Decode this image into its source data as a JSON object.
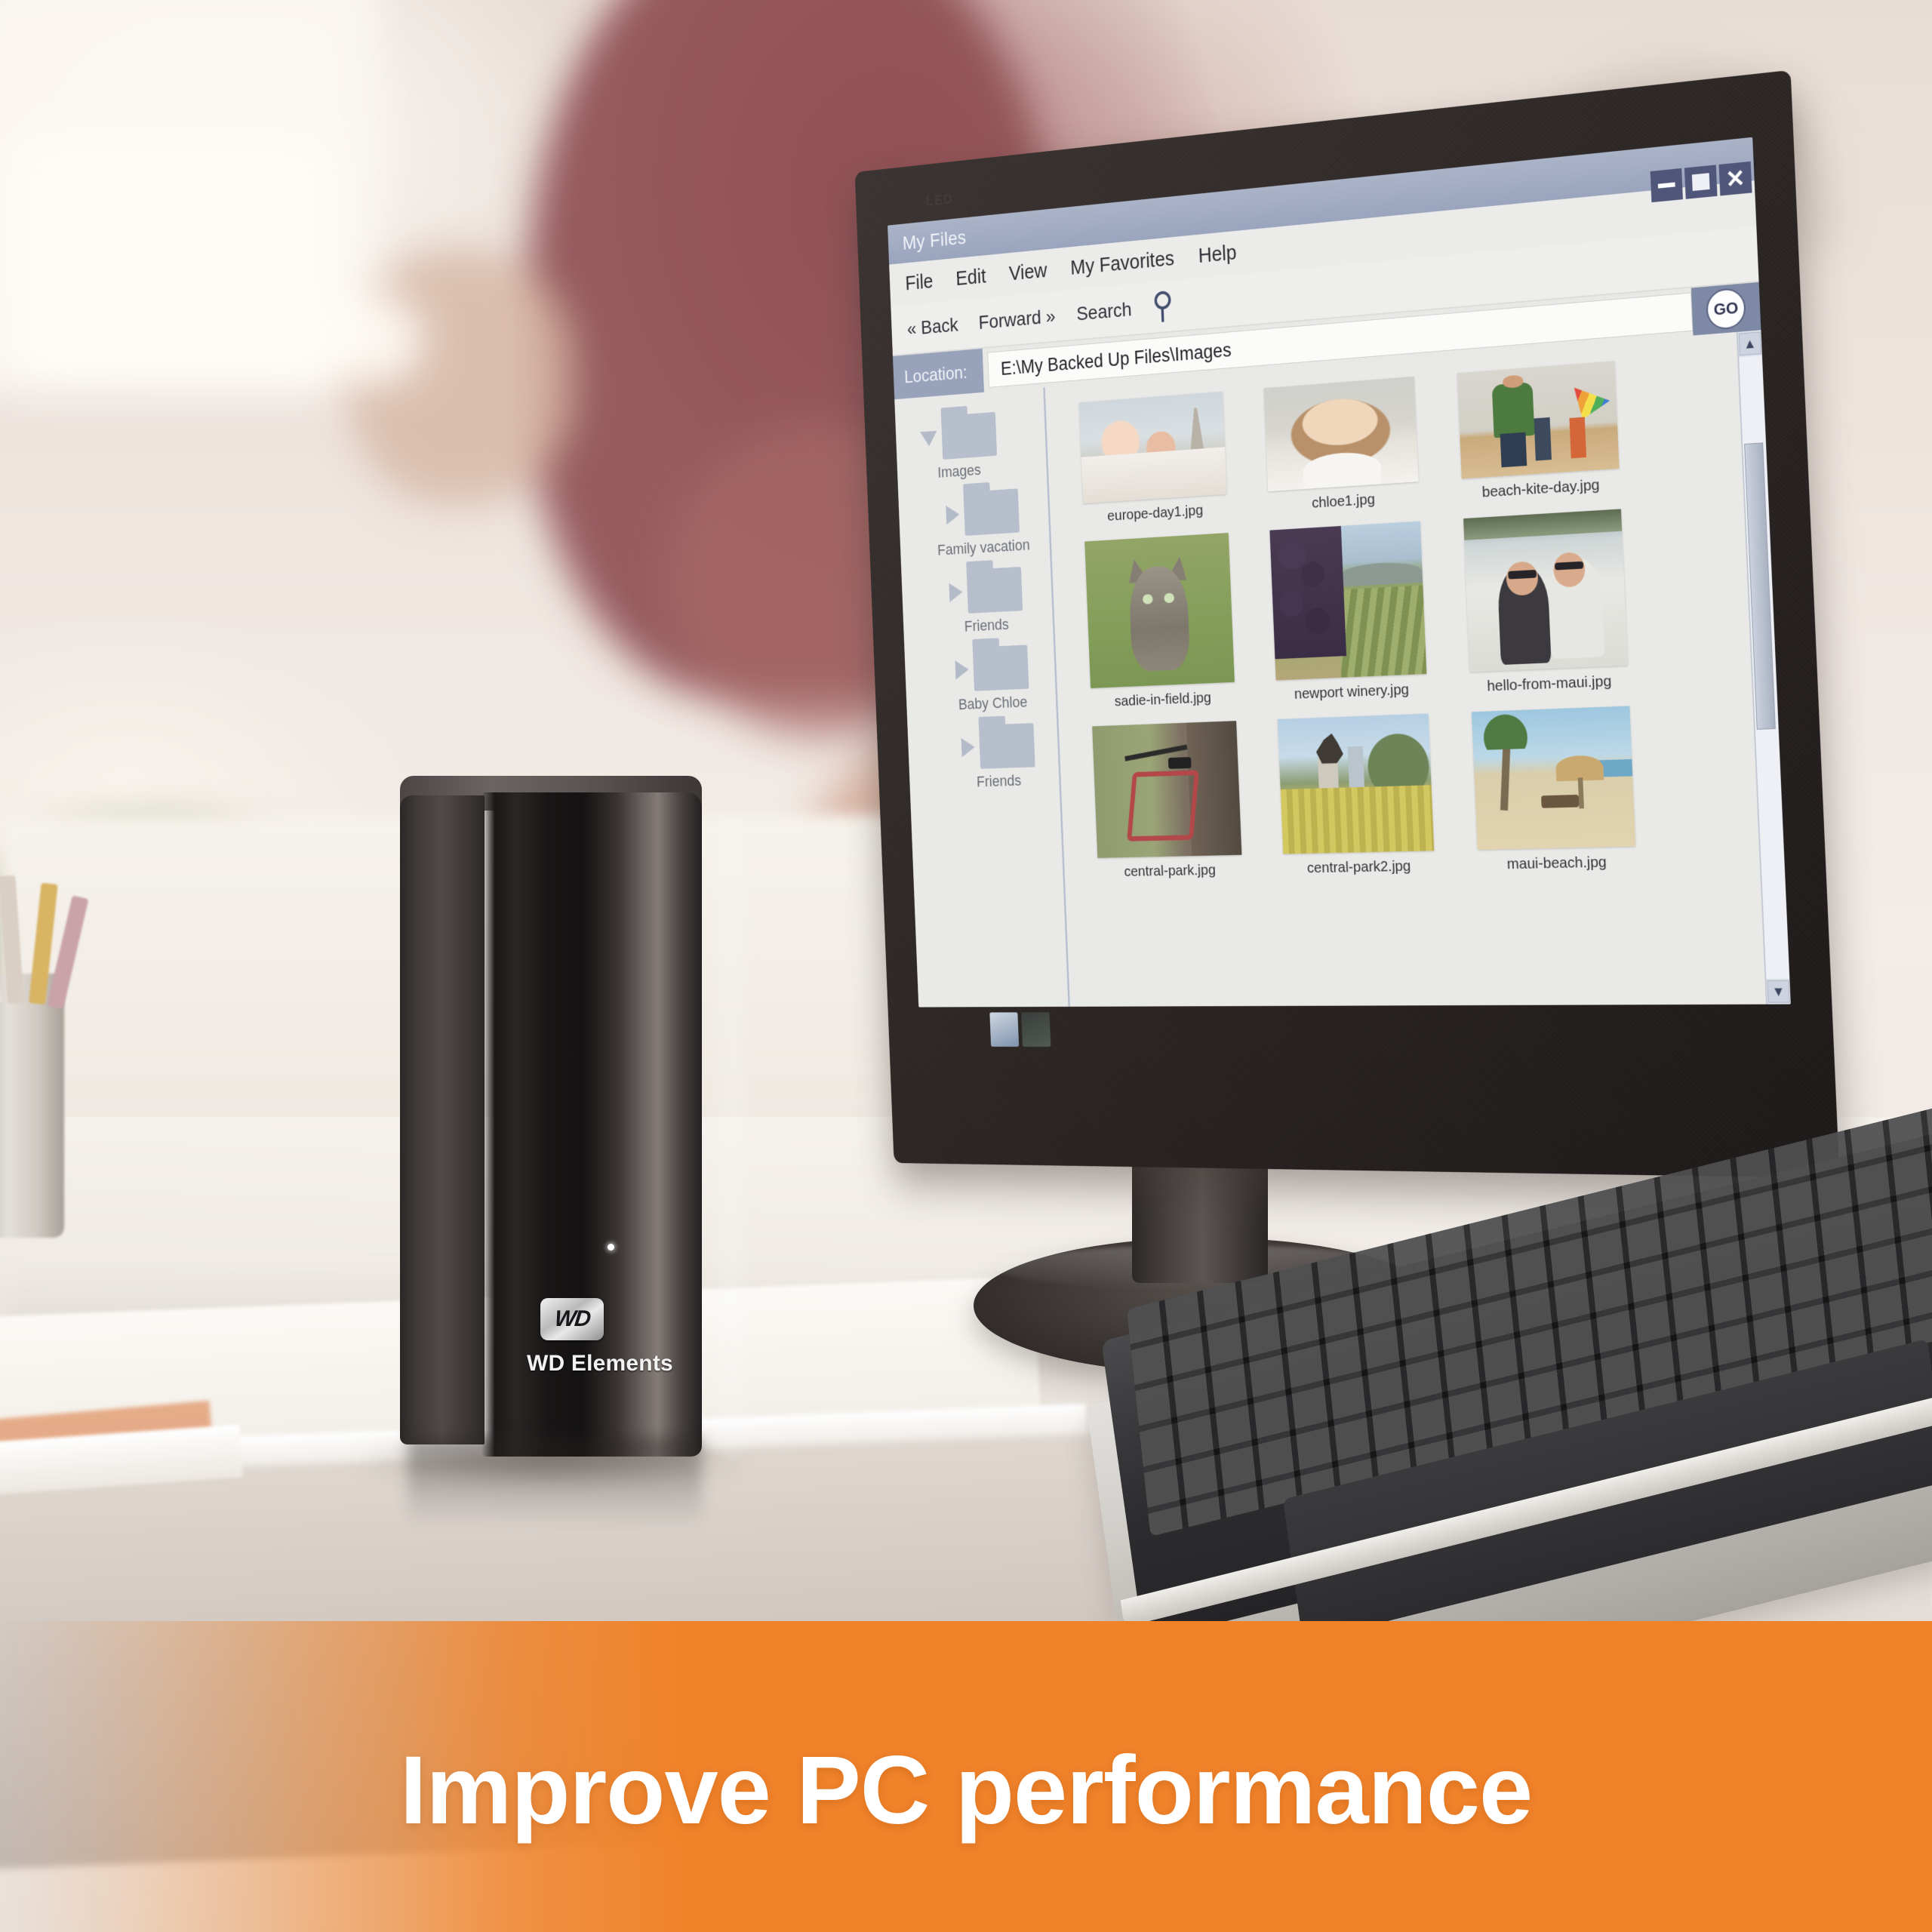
{
  "scene": {
    "monitor": {
      "bezel_label": "LED",
      "badges": [
        "energy-star-sticker",
        "eco-sticker"
      ]
    },
    "drive": {
      "brand_mark": "WD",
      "model_label": "WD Elements",
      "led_indicator": "power-led"
    }
  },
  "window": {
    "title": "My Files",
    "controls": {
      "minimize": "–",
      "maximize": "□",
      "close": "✕"
    },
    "menu": [
      "File",
      "Edit",
      "View",
      "My Favorites",
      "Help"
    ],
    "toolbar": {
      "back": "« Back",
      "forward": "Forward »",
      "search": "Search",
      "search_icon": "magnifier-icon"
    },
    "location": {
      "label": "Location:",
      "value": "E:\\My Backed Up Files\\Images",
      "go_label": "GO"
    },
    "tree": [
      {
        "label": "Images",
        "expanded": true,
        "indent": 0
      },
      {
        "label": "Family vacation",
        "expanded": false,
        "indent": 1
      },
      {
        "label": "Friends",
        "expanded": false,
        "indent": 1
      },
      {
        "label": "Baby Chloe",
        "expanded": false,
        "indent": 1
      },
      {
        "label": "Friends",
        "expanded": false,
        "indent": 1
      }
    ],
    "files": [
      {
        "name": "europe-day1.jpg",
        "art": "art-europe",
        "shape": "land"
      },
      {
        "name": "chloe1.jpg",
        "art": "art-chloe",
        "shape": "land"
      },
      {
        "name": "beach-kite-day.jpg",
        "art": "art-kite",
        "shape": "land"
      },
      {
        "name": "sadie-in-field.jpg",
        "art": "art-sadie",
        "shape": "port"
      },
      {
        "name": "newport winery.jpg",
        "art": "art-winery",
        "shape": "port"
      },
      {
        "name": "hello-from-maui.jpg",
        "art": "art-maui",
        "shape": "port"
      },
      {
        "name": "central-park.jpg",
        "art": "art-cp",
        "shape": "sq"
      },
      {
        "name": "central-park2.jpg",
        "art": "art-cp2",
        "shape": "sq"
      },
      {
        "name": "maui-beach.jpg",
        "art": "art-mb",
        "shape": "sq"
      }
    ],
    "scrollbar": {
      "up_arrow": "▲",
      "down_arrow": "▼"
    }
  },
  "banner": {
    "headline": "Improve PC performance",
    "background_color": "#f0822a",
    "text_color": "#ffffff"
  }
}
